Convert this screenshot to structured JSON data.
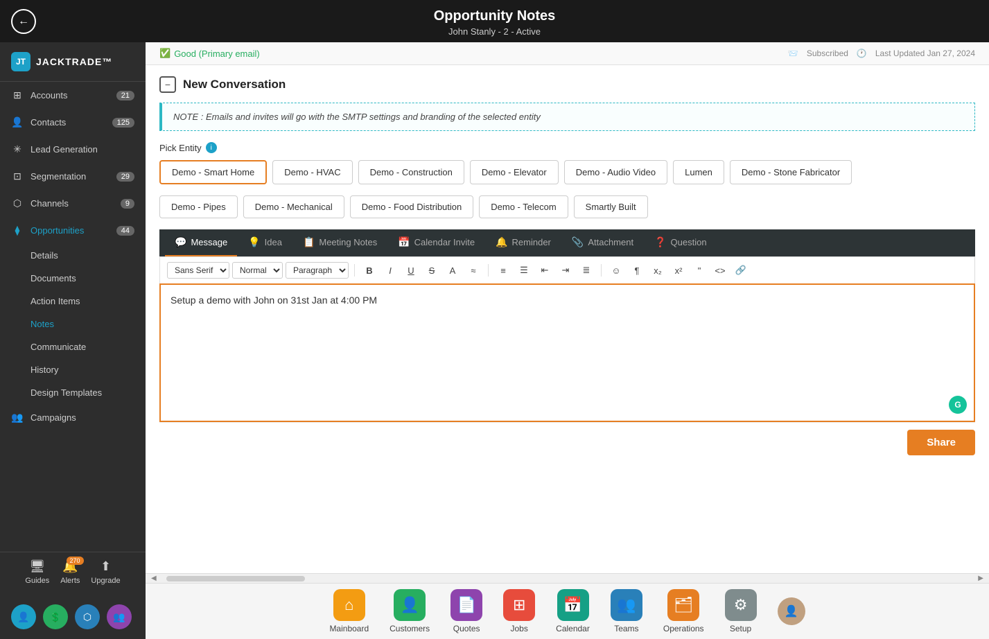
{
  "header": {
    "title": "Opportunity Notes",
    "subtitle": "John Stanly - 2 - Active",
    "back_label": "←"
  },
  "top_strip": {
    "email_status": "Good (Primary email)",
    "subscribed": "Subscribed",
    "last_updated": "Last Updated Jan 27, 2024"
  },
  "sidebar": {
    "logo_text": "JACKTRADE™",
    "nav_items": [
      {
        "label": "Accounts",
        "badge": "21",
        "icon": "⊞"
      },
      {
        "label": "Contacts",
        "badge": "125",
        "icon": "👤"
      },
      {
        "label": "Lead Generation",
        "badge": "",
        "icon": "✳"
      },
      {
        "label": "Segmentation",
        "badge": "29",
        "icon": "⊡"
      },
      {
        "label": "Channels",
        "badge": "9",
        "icon": "⬡"
      },
      {
        "label": "Opportunities",
        "badge": "44",
        "icon": "⧫",
        "active": true
      }
    ],
    "sub_items": [
      {
        "label": "Details"
      },
      {
        "label": "Documents"
      },
      {
        "label": "Action Items"
      },
      {
        "label": "Notes",
        "active": true
      },
      {
        "label": "Communicate"
      },
      {
        "label": "History"
      },
      {
        "label": "Design Templates"
      }
    ],
    "more_items": [
      {
        "label": "Campaigns",
        "icon": "👥"
      }
    ],
    "bottom_nav": [
      {
        "label": "Guides",
        "icon": "🖥"
      },
      {
        "label": "Alerts",
        "icon": "🔔",
        "badge": "270"
      },
      {
        "label": "Upgrade",
        "icon": "↑"
      }
    ],
    "bottom_icons": [
      "👤",
      "💲",
      "⬡",
      "👥"
    ]
  },
  "content": {
    "section_title": "New Conversation",
    "note_text": "NOTE : Emails and invites will go with the SMTP settings and branding of the selected entity",
    "pick_entity_label": "Pick Entity",
    "entities_row1": [
      {
        "label": "Demo - Smart Home",
        "selected": true
      },
      {
        "label": "Demo - HVAC"
      },
      {
        "label": "Demo - Construction"
      },
      {
        "label": "Demo - Elevator"
      },
      {
        "label": "Demo - Audio Video"
      },
      {
        "label": "Lumen"
      },
      {
        "label": "Demo - Stone Fabricator"
      }
    ],
    "entities_row2": [
      {
        "label": "Demo - Pipes"
      },
      {
        "label": "Demo - Mechanical"
      },
      {
        "label": "Demo - Food Distribution"
      },
      {
        "label": "Demo - Telecom"
      },
      {
        "label": "Smartly Built"
      }
    ],
    "tabs": [
      {
        "label": "Message",
        "icon": "💬",
        "active": true
      },
      {
        "label": "Idea",
        "icon": "💡"
      },
      {
        "label": "Meeting Notes",
        "icon": "📋"
      },
      {
        "label": "Calendar Invite",
        "icon": "📅"
      },
      {
        "label": "Reminder",
        "icon": "🔔"
      },
      {
        "label": "Attachment",
        "icon": "📎"
      },
      {
        "label": "Question",
        "icon": "❓"
      }
    ],
    "toolbar": {
      "font": "Sans Serif",
      "size": "Normal",
      "style": "Paragraph"
    },
    "editor_text": "Setup a demo with John on 31st Jan at 4:00 PM",
    "share_label": "Share"
  },
  "bottom_nav": {
    "items": [
      {
        "label": "Mainboard",
        "color": "hex-yellow",
        "icon": "⌂"
      },
      {
        "label": "Customers",
        "color": "hex-green",
        "icon": "👤"
      },
      {
        "label": "Quotes",
        "color": "hex-purple",
        "icon": "📄"
      },
      {
        "label": "Jobs",
        "color": "hex-red",
        "icon": "⊞"
      },
      {
        "label": "Calendar",
        "color": "hex-teal",
        "icon": "📅"
      },
      {
        "label": "Teams",
        "color": "hex-blue",
        "icon": "👥"
      },
      {
        "label": "Operations",
        "color": "hex-orange",
        "icon": "🗂"
      },
      {
        "label": "Setup",
        "color": "hex-gray",
        "icon": "⚙"
      }
    ]
  }
}
